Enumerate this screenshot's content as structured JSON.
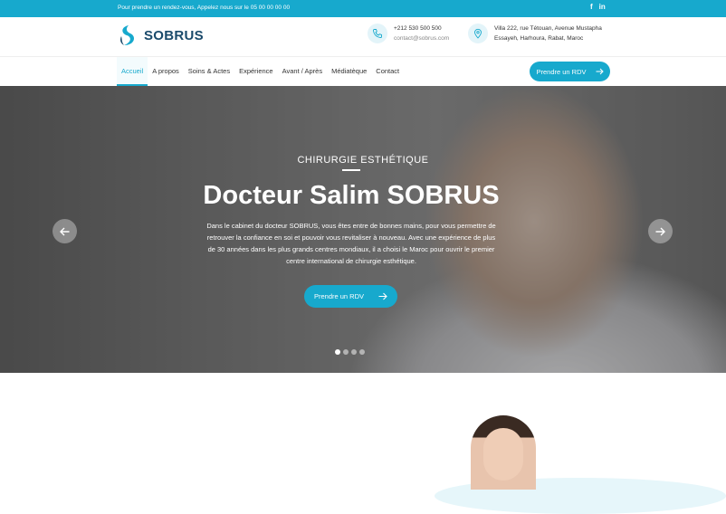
{
  "topbar": {
    "message": "Pour prendre un rendez-vous, Appelez nous sur le 05 00 00 00 00",
    "social": [
      {
        "label": "f",
        "icon": "facebook-icon"
      },
      {
        "label": "in",
        "icon": "linkedin-icon"
      }
    ]
  },
  "header": {
    "logo_text": "SOBRUS",
    "phone": "+212 530 500 500",
    "email": "contact@sobrus.com",
    "address_line1": "Villa 222, rue Tétouan, Avenue Mustapha",
    "address_line2": "Essayeh, Harhoura, Rabat, Maroc"
  },
  "nav": {
    "items": [
      "Accueil",
      "A propos",
      "Soins & Actes",
      "Expérience",
      "Avant / Après",
      "Médiatèque",
      "Contact"
    ],
    "active": "Accueil",
    "cta_label": "Prendre un RDV"
  },
  "hero": {
    "subtitle": "CHIRURGIE ESTHÉTIQUE",
    "title": "Docteur Salim SOBRUS",
    "paragraph": "Dans le cabinet du docteur SOBRUS, vous êtes entre de bonnes mains, pour vous permettre de retrouver la confiance en soi et pouvoir vous revitaliser à nouveau. Avec une expérience de plus de 30 années dans les plus grands centres mondiaux, il a choisi le Maroc pour ouvrir le premier centre international de chirurgie esthétique.",
    "cta_label": "Prendre un RDV",
    "slides_count": 4,
    "active_slide": 1
  },
  "colors": {
    "accent": "#17a9cd",
    "logo": "#1a4a6b"
  }
}
